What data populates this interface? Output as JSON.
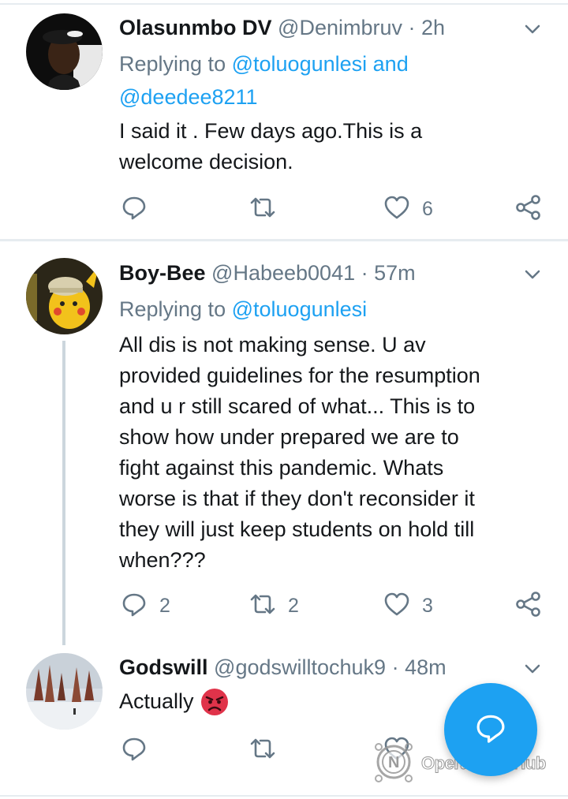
{
  "tweets": [
    {
      "name": "Olasunmbo DV",
      "handle": "@Denimbruv",
      "time": "2h",
      "reply_prefix": "Replying to",
      "reply_mention_1": "@toluogunlesi",
      "reply_and": "and",
      "reply_mention_2": "@deedee8211",
      "text_lines": [
        "I said it . Few days ago.This is a",
        "welcome decision."
      ],
      "reply_count": "",
      "retweet_count": "",
      "like_count": "6"
    },
    {
      "name": "Boy-Bee",
      "handle": "@Habeeb0041",
      "time": "57m",
      "reply_prefix": "Replying to",
      "reply_mention_1": "@toluogunlesi",
      "text_lines": [
        "All dis is not making sense. U av",
        "provided guidelines for the resumption",
        "and u r still scared of what... This is to",
        "show how under prepared we are to",
        "fight against this pandemic. Whats",
        "worse is that if they don't reconsider it",
        "they will just keep students on hold till",
        "when???"
      ],
      "reply_count": "2",
      "retweet_count": "2",
      "like_count": "3"
    },
    {
      "name": "Godswill",
      "handle": "@godswilltochuk9",
      "time": "48m",
      "text": "Actually",
      "emoji": "angry-face-emoji"
    }
  ],
  "separator": "·",
  "watermark": {
    "text": "OperaNewsHub"
  },
  "colors": {
    "accent": "#1da1f2",
    "secondary_text": "#657786",
    "primary_text": "#14171a",
    "divider": "#e6ecf0",
    "angry_emoji": "#e0334a"
  },
  "icons": [
    "reply-icon",
    "retweet-icon",
    "like-icon",
    "share-icon",
    "chevron-down-icon",
    "compose-reply-icon"
  ]
}
